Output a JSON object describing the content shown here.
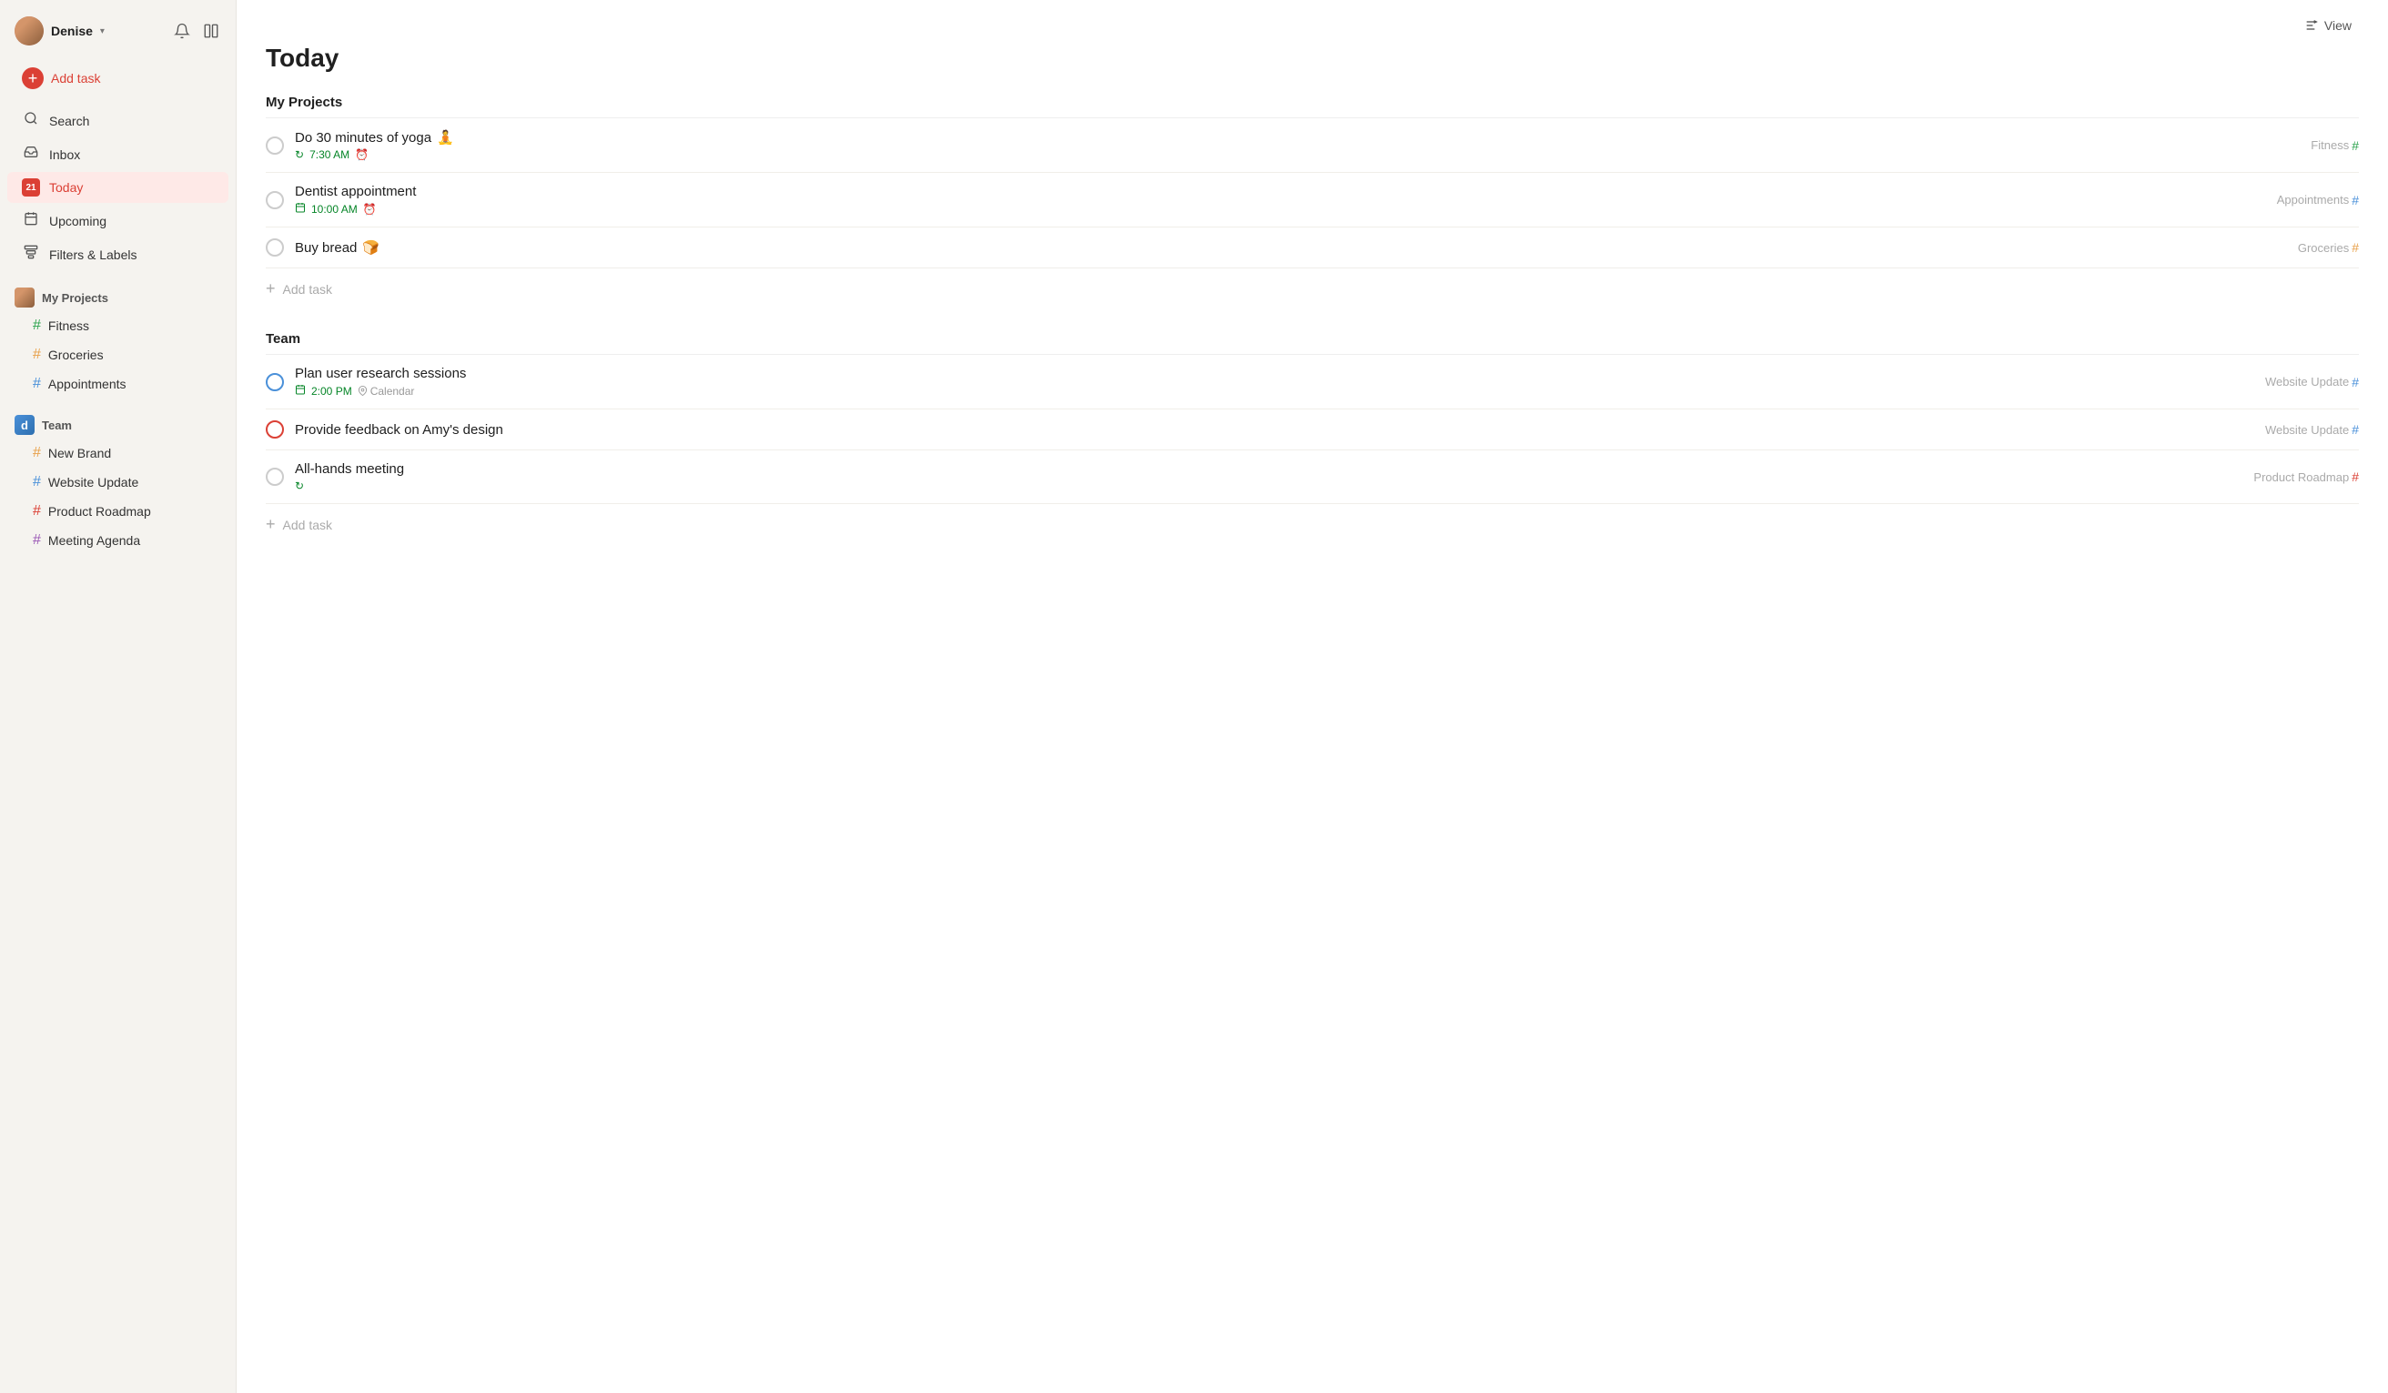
{
  "sidebar": {
    "user": {
      "name": "Denise",
      "chevron": "▾"
    },
    "nav": [
      {
        "id": "add-task",
        "label": "Add task",
        "icon": "+",
        "type": "action"
      },
      {
        "id": "search",
        "label": "Search",
        "icon": "🔍",
        "type": "nav"
      },
      {
        "id": "inbox",
        "label": "Inbox",
        "icon": "📥",
        "type": "nav"
      },
      {
        "id": "today",
        "label": "Today",
        "icon": "21",
        "type": "nav",
        "active": true
      },
      {
        "id": "upcoming",
        "label": "Upcoming",
        "icon": "📅",
        "type": "nav"
      },
      {
        "id": "filters",
        "label": "Filters & Labels",
        "icon": "⊞",
        "type": "nav"
      }
    ],
    "myProjects": {
      "title": "My Projects",
      "items": [
        {
          "id": "fitness",
          "label": "Fitness",
          "hashColor": "green"
        },
        {
          "id": "groceries",
          "label": "Groceries",
          "hashColor": "orange"
        },
        {
          "id": "appointments",
          "label": "Appointments",
          "hashColor": "blue"
        }
      ]
    },
    "team": {
      "title": "Team",
      "items": [
        {
          "id": "new-brand",
          "label": "New Brand",
          "hashColor": "orange"
        },
        {
          "id": "website-update",
          "label": "Website Update",
          "hashColor": "blue"
        },
        {
          "id": "product-roadmap",
          "label": "Product Roadmap",
          "hashColor": "red"
        },
        {
          "id": "meeting-agenda",
          "label": "Meeting Agenda",
          "hashColor": "purple"
        }
      ]
    }
  },
  "main": {
    "title": "Today",
    "viewLabel": "View",
    "sections": [
      {
        "id": "my-projects",
        "title": "My Projects",
        "tasks": [
          {
            "id": "task-yoga",
            "title": "Do 30 minutes of yoga",
            "emoji": "🧘",
            "time": "7:30 AM",
            "hasRecurring": true,
            "hasReminder": true,
            "project": "Fitness",
            "checkboxType": "default"
          },
          {
            "id": "task-dentist",
            "title": "Dentist appointment",
            "emoji": "",
            "time": "10:00 AM",
            "hasRecurring": false,
            "hasReminder": true,
            "hasCalendar": true,
            "project": "Appointments",
            "checkboxType": "default"
          },
          {
            "id": "task-bread",
            "title": "Buy bread",
            "emoji": "🍞",
            "time": "",
            "hasRecurring": false,
            "hasReminder": false,
            "project": "Groceries",
            "checkboxType": "default"
          }
        ],
        "addTaskLabel": "Add task"
      },
      {
        "id": "team",
        "title": "Team",
        "tasks": [
          {
            "id": "task-research",
            "title": "Plan user research sessions",
            "emoji": "",
            "time": "2:00 PM",
            "hasCalendar": true,
            "calendarLabel": "Calendar",
            "project": "Website Update",
            "checkboxType": "blue"
          },
          {
            "id": "task-feedback",
            "title": "Provide feedback on Amy's design",
            "emoji": "",
            "time": "",
            "project": "Website Update",
            "checkboxType": "red"
          },
          {
            "id": "task-allhands",
            "title": "All-hands meeting",
            "emoji": "",
            "time": "",
            "hasRecurring": true,
            "project": "Product Roadmap",
            "checkboxType": "default"
          }
        ],
        "addTaskLabel": "Add task"
      }
    ]
  }
}
